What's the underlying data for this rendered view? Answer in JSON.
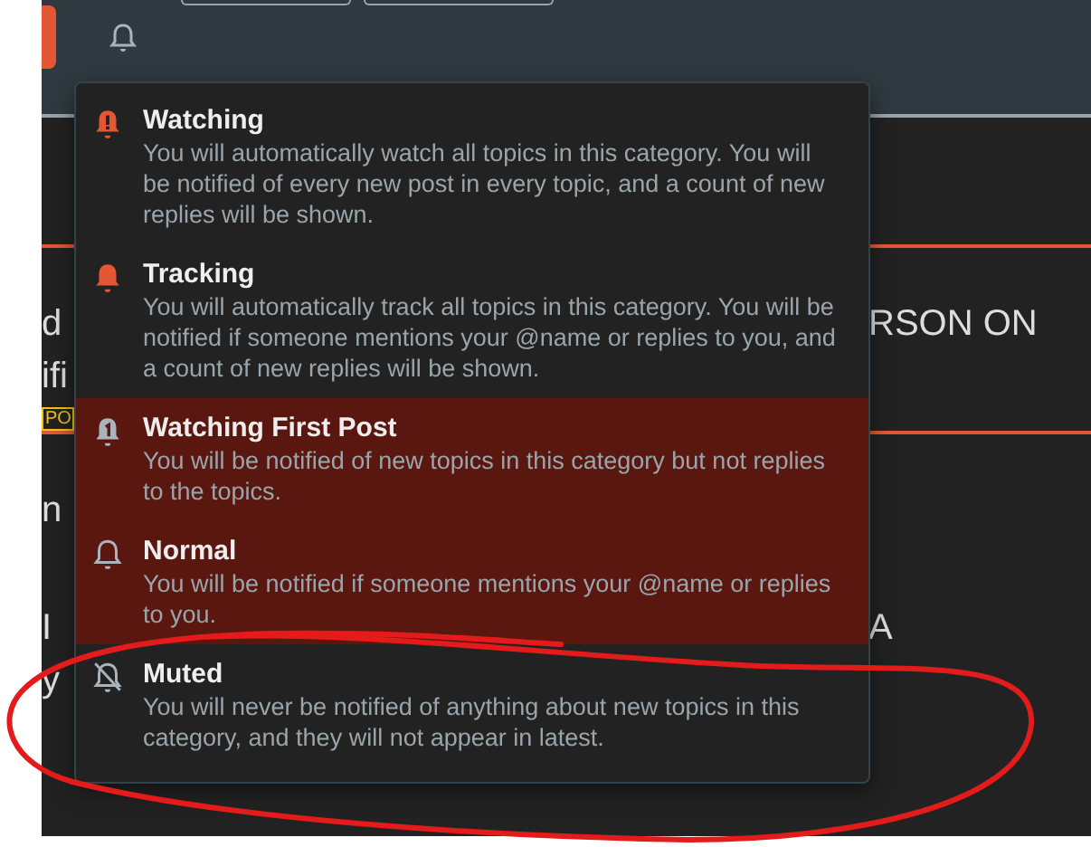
{
  "topics": [
    {
      "ruled": true,
      "left_lines": [
        "d",
        "ifi"
      ],
      "badge": "PO",
      "right_lines": [
        "RSON ON"
      ]
    },
    {
      "ruled": true,
      "left_lines": [
        "n"
      ]
    },
    {
      "ruled": false,
      "left_lines": [
        "I",
        "y"
      ],
      "right_lines": [
        "A"
      ]
    }
  ],
  "notification_menu": {
    "items": [
      {
        "kind": "watching",
        "title": "Watching",
        "description": "You will automatically watch all topics in this category. You will be notified of every new post in every topic, and a count of new replies will be shown.",
        "highlighted": false
      },
      {
        "kind": "tracking",
        "title": "Tracking",
        "description": "You will automatically track all topics in this category. You will be notified if someone mentions your @name or replies to you, and a count of new replies will be shown.",
        "highlighted": false
      },
      {
        "kind": "first",
        "title": "Watching First Post",
        "description": "You will be notified of new topics in this category but not replies to the topics.",
        "highlighted": true
      },
      {
        "kind": "normal",
        "title": "Normal",
        "description": "You will be notified if someone mentions your @name or replies to you.",
        "highlighted": true
      },
      {
        "kind": "muted",
        "title": "Muted",
        "description": "You will never be notified of anything about new topics in this category, and they will not appear in latest.",
        "highlighted": false
      }
    ]
  },
  "markup": [
    {
      "kind": "ellipse"
    }
  ]
}
